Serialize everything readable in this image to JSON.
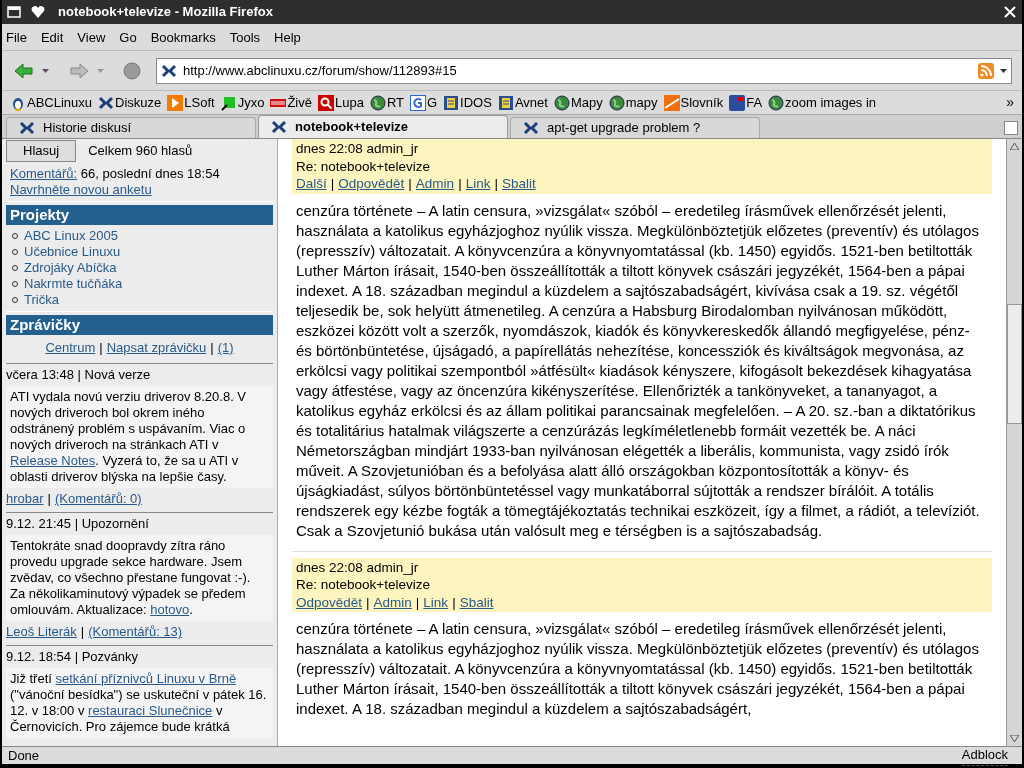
{
  "window": {
    "title": "notebook+televize - Mozilla Firefox"
  },
  "menu": [
    "File",
    "Edit",
    "View",
    "Go",
    "Bookmarks",
    "Tools",
    "Help"
  ],
  "address": {
    "value": "http://www.abclinuxu.cz/forum/show/112893#15"
  },
  "bookmarks": [
    {
      "label": "ABCLinuxu",
      "kind": "penguin"
    },
    {
      "label": "Diskuze",
      "kind": "logo"
    },
    {
      "label": "LSoft",
      "kind": "play"
    },
    {
      "label": "Jyxo",
      "kind": "jyxo"
    },
    {
      "label": "Živě",
      "kind": "zive"
    },
    {
      "label": "Lupa",
      "kind": "lupa"
    },
    {
      "label": "RT",
      "kind": "globe"
    },
    {
      "label": "G",
      "kind": "google"
    },
    {
      "label": "IDOS",
      "kind": "doc"
    },
    {
      "label": "Avnet",
      "kind": "doc"
    },
    {
      "label": "Mapy",
      "kind": "globe"
    },
    {
      "label": "mapy",
      "kind": "globe"
    },
    {
      "label": "Slovník",
      "kind": "slovnik"
    },
    {
      "label": "FA",
      "kind": "fa"
    },
    {
      "label": "zoom images in",
      "kind": "globe"
    }
  ],
  "bookmarks_more": "»",
  "tabs": [
    {
      "label": "Historie diskusí",
      "selected": false
    },
    {
      "label": "notebook+televize",
      "selected": true
    },
    {
      "label": "apt-get upgrade problem ?",
      "selected": false
    }
  ],
  "sidebar": {
    "poll": {
      "button": "Hlasuj",
      "total": "Celkem 960 hlasů",
      "comments_link": "Komentářů:",
      "comments_text": "66, poslední dnes 18:54",
      "suggest_link": "Navrhněte novou anketu"
    },
    "projects": {
      "title": "Projekty",
      "items": [
        "ABC Linux 2005",
        "Učebnice Linuxu",
        "Zdrojáky Abíčka",
        "Nakrmte tučňáka",
        "Trička"
      ]
    },
    "news": {
      "title": "Zprávičky",
      "links": [
        "Centrum",
        "Napsat zprávičku",
        "(1)"
      ],
      "separator": "|",
      "items": [
        {
          "header": "včera 13:48 | Nová verze",
          "body": [
            {
              "text": "ATI vydala novú verziu driverov 8.20.8. V nových driveroch bol okrem iného odstránený problém s uspávaním. Viac o nových driveroch na stránkach ATI v "
            },
            {
              "link": "Release Notes"
            },
            {
              "text": ". Vyzerá to, že sa u ATI v oblasti driverov blýska na lepšie časy."
            }
          ],
          "author": "hrobar",
          "comments": "(Komentářů: 0)"
        },
        {
          "header": "9.12. 21:45 | Upozornění",
          "body": [
            {
              "text": "Tentokráte snad doopravdy zítra ráno provedu upgrade sekce hardware. Jsem zvědav, co všechno přestane fungovat :-). Za několikaminutový výpadek se předem omlouvám. Aktualizace: "
            },
            {
              "link": "hotovo"
            },
            {
              "text": "."
            }
          ],
          "author": "Leoš Literák",
          "comments": "(Komentářů: 13)"
        },
        {
          "header": "9.12. 18:54 | Pozvánky",
          "body": [
            {
              "text": "Již třetí "
            },
            {
              "link": "setkání příznivců Linuxu v Brně"
            },
            {
              "text": " (\"vánoční besídka\") se uskuteční v pátek 16. 12. v 18:00 v "
            },
            {
              "link": "restauraci Slunečnice"
            },
            {
              "text": " v Černovicích. Pro zájemce bude krátká"
            }
          ]
        }
      ]
    }
  },
  "posts": [
    {
      "meta": "dnes 22:08 admin_jr",
      "subject": "Re: notebook+televize",
      "actions": [
        "Další",
        "Odpovědět",
        "Admin",
        "Link",
        "Sbalit"
      ],
      "body": "cenzúra története – A latin censura, »vizsgálat« szóból – eredetileg írásművek ellenőrzését jelenti, használata a katolikus egyházjoghoz nyúlik vissza. Megkülönböztetjük előzetes (preventív) és utólagos (represszív) változatait. A könyvcenzúra a könyvnyomtatással (kb. 1450) egyidős. 1521-ben betiltották Luther Márton írásait, 1540-ben összeállították a tiltott könyvek császári jegyzékét, 1564-ben a pápai indexet. A 18. században megindul a küzdelem a sajtószabadságért, kivívása csak a 19. sz. végétől teljesedik be, sok helyütt átmenetileg. A cenzúra a Habsburg Birodalomban nyilvánosan működött, eszközei között volt a szerzők, nyomdászok, kiadók és könyvkereskedők állandó megfigyelése, pénz- és börtönbüntetése, újságadó, a papírellátás nehezítése, koncessziók és kiváltságok megvonása, az erkölcsi vagy politikai szempontból »átfésült« kiadások kényszere, kifogásolt bekezdések kihagyatása vagy átfestése, vagy az öncenzúra kikényszerítése. Ellenőrizték a tankönyveket, a tananyagot, a katolikus egyház erkölcsi és az állam politikai parancsainak megfelelően. – A 20. sz.-ban a diktatórikus és totalitárius hatalmak világszerte a cenzúrázás legkíméletlenebb formáit vezették be. A náci Németországban mindjárt 1933-ban nyilvánosan elégették a liberális, kommunista, vagy zsidó írók műveit. A Szovjetunióban és a befolyása alatt álló országokban központosították a könyv- és újságkiadást, súlyos börtönbüntetéssel vagy munkatáborral sújtották a rendszer bírálóit. A totális rendszerek egy kézbe fogták a tömegtájékoztatás technikai eszközeit, így a filmet, a rádiót, a televíziót. Csak a Szovjetunió bukása után valósult meg e térségben is a sajtószabadság."
    },
    {
      "meta": "dnes 22:08 admin_jr",
      "subject": "Re: notebook+televize",
      "actions": [
        "Odpovědět",
        "Admin",
        "Link",
        "Sbalit"
      ],
      "body": "cenzúra története – A latin censura, »vizsgálat« szóból – eredetileg írásművek ellenőrzését jelenti, használata a katolikus egyházjoghoz nyúlik vissza. Megkülönböztetjük előzetes (preventív) és utólagos (represszív) változatait. A könyvcenzúra a könyvnyomtatással (kb. 1450) egyidős. 1521-ben betiltották Luther Márton írásait, 1540-ben összeállították a tiltott könyvek császári jegyzékét, 1564-ben a pápai indexet. A 18. században megindul a küzdelem a sajtószabadságért,"
    }
  ],
  "status": {
    "text": "Done",
    "adblock": "Adblock"
  }
}
